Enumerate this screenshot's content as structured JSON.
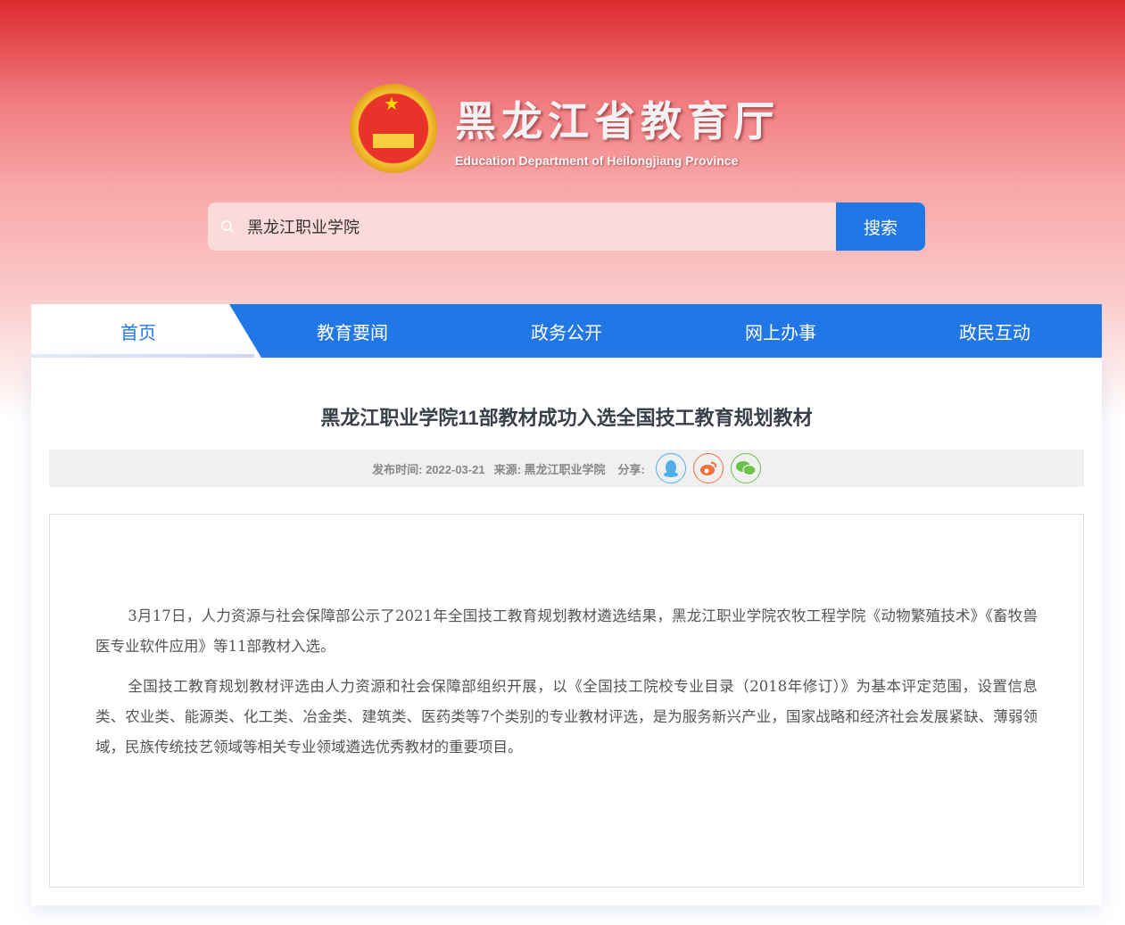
{
  "header": {
    "title_cn": "黑龙江省教育厅",
    "title_en": "Education Department of Heilongjiang Province"
  },
  "search": {
    "value": "黑龙江职业学院",
    "button": "搜索"
  },
  "nav": [
    "首页",
    "教育要闻",
    "政务公开",
    "网上办事",
    "政民互动"
  ],
  "article": {
    "title": "黑龙江职业学院11部教材成功入选全国技工教育规划教材",
    "meta": {
      "date": "发布时间: 2022-03-21",
      "source": "来源: 黑龙江职业学院",
      "share": "分享:"
    },
    "paragraphs": [
      "3月17日，人力资源与社会保障部公示了2021年全国技工教育规划教材遴选结果，黑龙江职业学院农牧工程学院《动物繁殖技术》《畜牧兽医专业软件应用》等11部教材入选。",
      "全国技工教育规划教材评选由人力资源和社会保障部组织开展，以《全国技工院校专业目录（2018年修订）》为基本评定范围，设置信息类、农业类、能源类、化工类、冶金类、建筑类、医药类等7个类别的专业教材评选，是为服务新兴产业，国家战略和经济社会发展紧缺、薄弱领域，民族传统技艺领域等相关专业领域遴选优秀教材的重要项目。"
    ]
  },
  "colors": {
    "primary": "#2277e6",
    "qq": "#4fb0e8",
    "weibo": "#f2703a",
    "wechat": "#6cc24a"
  }
}
